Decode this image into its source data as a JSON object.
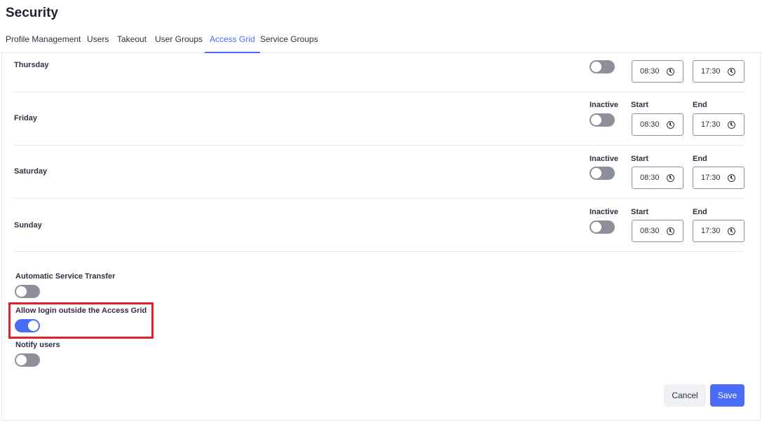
{
  "header": {
    "title": "Security"
  },
  "tabs": [
    {
      "label": "Profile Management"
    },
    {
      "label": "Users"
    },
    {
      "label": "Takeout"
    },
    {
      "label": "User Groups"
    },
    {
      "label": "Access Grid",
      "active": true
    },
    {
      "label": "Service Groups"
    }
  ],
  "columns": {
    "inactive": "Inactive",
    "start": "Start",
    "end": "End"
  },
  "days": [
    {
      "label": "Thursday",
      "inactive": false,
      "start": "08:30",
      "end": "17:30"
    },
    {
      "label": "Friday",
      "inactive": false,
      "start": "08:30",
      "end": "17:30"
    },
    {
      "label": "Saturday",
      "inactive": false,
      "start": "08:30",
      "end": "17:30"
    },
    {
      "label": "Sunday",
      "inactive": false,
      "start": "08:30",
      "end": "17:30"
    }
  ],
  "settings": [
    {
      "label": "Automatic Service Transfer",
      "enabled": false
    },
    {
      "label": "Allow login outside the Access Grid",
      "enabled": true
    },
    {
      "label": "Notify users",
      "enabled": false
    }
  ],
  "actions": {
    "cancel_label": "Cancel",
    "save_label": "Save"
  },
  "colors": {
    "accent": "#4a6cf7",
    "highlight": "#e0202a",
    "toggle_off": "#8d909a"
  }
}
